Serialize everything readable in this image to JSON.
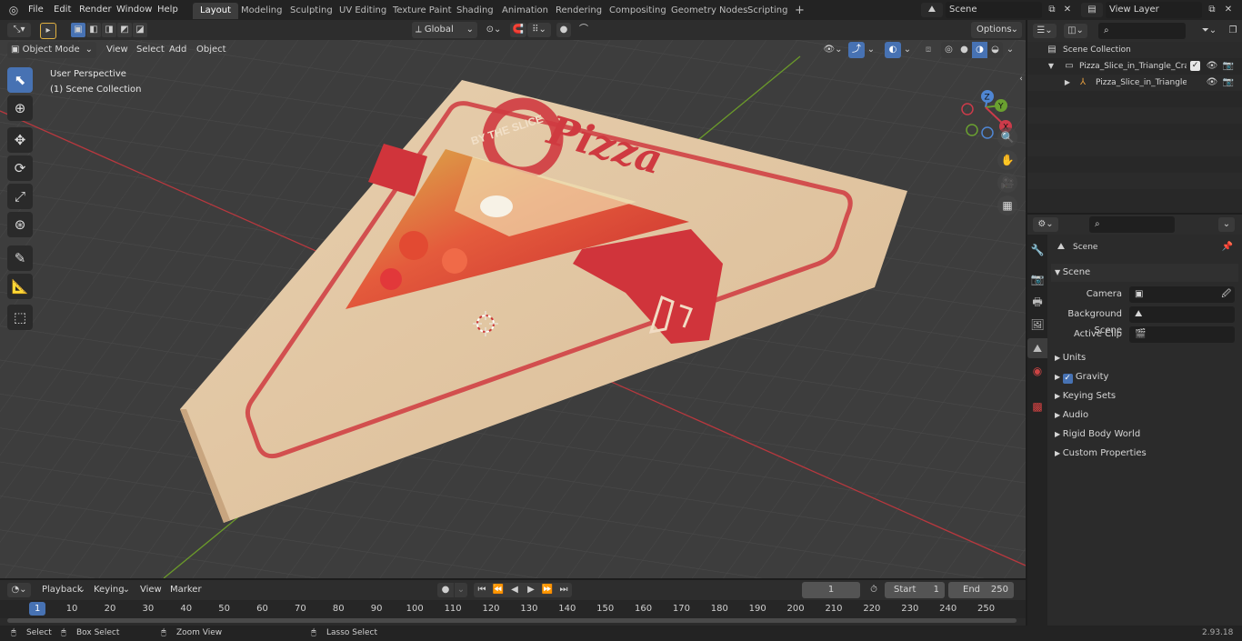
{
  "topbar": {
    "menus": [
      "File",
      "Edit",
      "Render",
      "Window",
      "Help"
    ],
    "workspaces": [
      "Layout",
      "Modeling",
      "Sculpting",
      "UV Editing",
      "Texture Paint",
      "Shading",
      "Animation",
      "Rendering",
      "Compositing",
      "Geometry Nodes",
      "Scripting"
    ],
    "active_workspace": "Layout",
    "add_tab": "+",
    "scene_name": "Scene",
    "view_layer_name": "View Layer"
  },
  "viewport_header": {
    "mode": "Object Mode",
    "menus": [
      "View",
      "Select",
      "Add",
      "Object"
    ],
    "transform_orientation": "Global",
    "options_label": "Options"
  },
  "viewport": {
    "perspective_label": "User Perspective",
    "collection_label": "(1) Scene Collection",
    "gizmo_axes": [
      "Z",
      "Y",
      "X"
    ]
  },
  "outliner": {
    "root": "Scene Collection",
    "items": [
      {
        "label": "Pizza_Slice_in_Triangle_Craft_"
      },
      {
        "label": "Pizza_Slice_in_Triangle_C"
      }
    ]
  },
  "properties": {
    "context_title": "Scene",
    "section_title": "Scene",
    "camera_label": "Camera",
    "background_scene_label": "Background Scene",
    "active_clip_label": "Active Clip",
    "panels": [
      "Units",
      "Gravity",
      "Keying Sets",
      "Audio",
      "Rigid Body World",
      "Custom Properties"
    ],
    "gravity_checked": true
  },
  "timeline": {
    "menus": [
      "Playback",
      "Keying",
      "View",
      "Marker"
    ],
    "current_frame": "1",
    "start_label": "Start",
    "start_value": "1",
    "end_label": "End",
    "end_value": "250",
    "ticks": [
      "1",
      "10",
      "20",
      "30",
      "40",
      "50",
      "60",
      "70",
      "80",
      "90",
      "100",
      "110",
      "120",
      "130",
      "140",
      "150",
      "160",
      "170",
      "180",
      "190",
      "200",
      "210",
      "220",
      "230",
      "240",
      "250"
    ]
  },
  "statusbar": {
    "select": "Select",
    "box_select": "Box Select",
    "zoom_view": "Zoom View",
    "lasso_select": "Lasso Select",
    "version": "2.93.18"
  },
  "colors": {
    "accent": "#4772b3",
    "x_axis": "#b8383e",
    "y_axis": "#6b9a2a",
    "box": "#e2c7a4",
    "box_red": "#d0343b"
  },
  "box_print": {
    "brand_ring": "BY THE SLICE",
    "brand_word": "Pizza"
  }
}
